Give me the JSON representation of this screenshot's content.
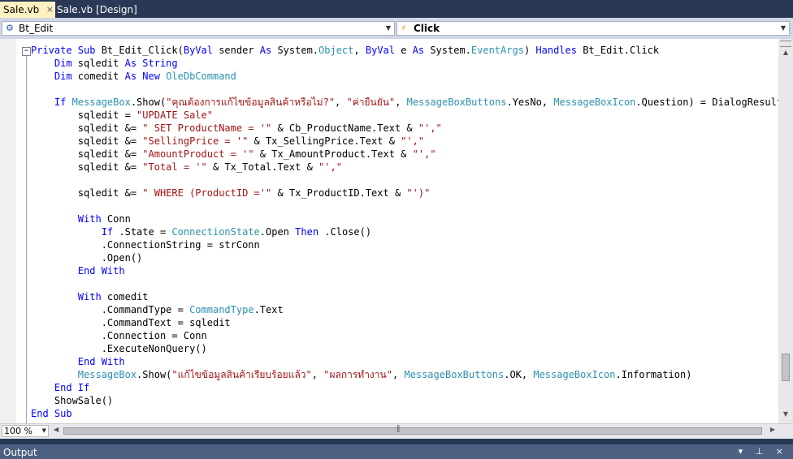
{
  "tabs": [
    {
      "label": "Sale.vb",
      "close": "×"
    },
    {
      "label": "Sale.vb [Design]"
    }
  ],
  "nav": {
    "class_combo": "Bt_Edit",
    "method_combo": "Click"
  },
  "code_lines": [
    [
      {
        "t": "Private Sub ",
        "c": "kw"
      },
      {
        "t": "Bt_Edit_Click(",
        "c": ""
      },
      {
        "t": "ByVal",
        "c": "kw"
      },
      {
        "t": " sender ",
        "c": ""
      },
      {
        "t": "As",
        "c": "kw"
      },
      {
        "t": " System.",
        "c": ""
      },
      {
        "t": "Object",
        "c": "ty"
      },
      {
        "t": ", ",
        "c": ""
      },
      {
        "t": "ByVal",
        "c": "kw"
      },
      {
        "t": " e ",
        "c": ""
      },
      {
        "t": "As",
        "c": "kw"
      },
      {
        "t": " System.",
        "c": ""
      },
      {
        "t": "EventArgs",
        "c": "ty"
      },
      {
        "t": ") ",
        "c": ""
      },
      {
        "t": "Handles",
        "c": "kw"
      },
      {
        "t": " Bt_Edit.Click",
        "c": ""
      }
    ],
    [
      {
        "t": "    Dim",
        "c": "kw"
      },
      {
        "t": " sqledit ",
        "c": ""
      },
      {
        "t": "As String",
        "c": "kw"
      }
    ],
    [
      {
        "t": "    Dim",
        "c": "kw"
      },
      {
        "t": " comedit ",
        "c": ""
      },
      {
        "t": "As New ",
        "c": "kw"
      },
      {
        "t": "OleDbCommand",
        "c": "ty"
      }
    ],
    [],
    [
      {
        "t": "    If ",
        "c": "kw"
      },
      {
        "t": "MessageBox",
        "c": "ty"
      },
      {
        "t": ".Show(",
        "c": ""
      },
      {
        "t": "\"คุณต้องการแก้ไขข้อมูลสินค้าหรือไม่?\"",
        "c": "st"
      },
      {
        "t": ", ",
        "c": ""
      },
      {
        "t": "\"ค่ายืนยัน\"",
        "c": "st"
      },
      {
        "t": ", ",
        "c": ""
      },
      {
        "t": "MessageBoxButtons",
        "c": "ty"
      },
      {
        "t": ".YesNo, ",
        "c": ""
      },
      {
        "t": "MessageBoxIcon",
        "c": "ty"
      },
      {
        "t": ".Question) = DialogResult.Ye",
        "c": ""
      }
    ],
    [
      {
        "t": "        sqledit = ",
        "c": ""
      },
      {
        "t": "\"UPDATE Sale\"",
        "c": "st"
      }
    ],
    [
      {
        "t": "        sqledit &= ",
        "c": ""
      },
      {
        "t": "\" SET ProductName = '\"",
        "c": "st"
      },
      {
        "t": " & Cb_ProductName.Text & ",
        "c": ""
      },
      {
        "t": "\"',\"",
        "c": "st"
      }
    ],
    [
      {
        "t": "        sqledit &= ",
        "c": ""
      },
      {
        "t": "\"SellingPrice = '\"",
        "c": "st"
      },
      {
        "t": " & Tx_SellingPrice.Text & ",
        "c": ""
      },
      {
        "t": "\"',\"",
        "c": "st"
      }
    ],
    [
      {
        "t": "        sqledit &= ",
        "c": ""
      },
      {
        "t": "\"AmountProduct = '\"",
        "c": "st"
      },
      {
        "t": " & Tx_AmountProduct.Text & ",
        "c": ""
      },
      {
        "t": "\"',\"",
        "c": "st"
      }
    ],
    [
      {
        "t": "        sqledit &= ",
        "c": ""
      },
      {
        "t": "\"Total = '\"",
        "c": "st"
      },
      {
        "t": " & Tx_Total.Text & ",
        "c": ""
      },
      {
        "t": "\"',\"",
        "c": "st"
      }
    ],
    [],
    [
      {
        "t": "        sqledit &= ",
        "c": ""
      },
      {
        "t": "\" WHERE (ProductID ='\"",
        "c": "st"
      },
      {
        "t": " & Tx_ProductID.Text & ",
        "c": ""
      },
      {
        "t": "\"')\"",
        "c": "st"
      }
    ],
    [],
    [
      {
        "t": "        With",
        "c": "kw"
      },
      {
        "t": " Conn",
        "c": ""
      }
    ],
    [
      {
        "t": "            If",
        "c": "kw"
      },
      {
        "t": " .State = ",
        "c": ""
      },
      {
        "t": "ConnectionState",
        "c": "ty"
      },
      {
        "t": ".Open ",
        "c": ""
      },
      {
        "t": "Then",
        "c": "kw"
      },
      {
        "t": " .Close()",
        "c": ""
      }
    ],
    [
      {
        "t": "            .ConnectionString = strConn",
        "c": ""
      }
    ],
    [
      {
        "t": "            .Open()",
        "c": ""
      }
    ],
    [
      {
        "t": "        End With",
        "c": "kw"
      }
    ],
    [],
    [
      {
        "t": "        With",
        "c": "kw"
      },
      {
        "t": " comedit",
        "c": ""
      }
    ],
    [
      {
        "t": "            .CommandType = ",
        "c": ""
      },
      {
        "t": "CommandType",
        "c": "ty"
      },
      {
        "t": ".Text",
        "c": ""
      }
    ],
    [
      {
        "t": "            .CommandText = sqledit",
        "c": ""
      }
    ],
    [
      {
        "t": "            .Connection = Conn",
        "c": ""
      }
    ],
    [
      {
        "t": "            .ExecuteNonQuery()",
        "c": ""
      }
    ],
    [
      {
        "t": "        End With",
        "c": "kw"
      }
    ],
    [
      {
        "t": "        ",
        "c": ""
      },
      {
        "t": "MessageBox",
        "c": "ty"
      },
      {
        "t": ".Show(",
        "c": ""
      },
      {
        "t": "\"แก้ไขข้อมูลสินค้าเรียบร้อยแล้ว\"",
        "c": "st"
      },
      {
        "t": ", ",
        "c": ""
      },
      {
        "t": "\"ผลการทำงาน\"",
        "c": "st"
      },
      {
        "t": ", ",
        "c": ""
      },
      {
        "t": "MessageBoxButtons",
        "c": "ty"
      },
      {
        "t": ".OK, ",
        "c": ""
      },
      {
        "t": "MessageBoxIcon",
        "c": "ty"
      },
      {
        "t": ".Information)",
        "c": ""
      }
    ],
    [
      {
        "t": "    End If",
        "c": "kw"
      }
    ],
    [
      {
        "t": "    ShowSale()",
        "c": ""
      }
    ],
    [
      {
        "t": "End Sub",
        "c": "kw"
      }
    ]
  ],
  "zoom": "100 %",
  "output_panel": {
    "title": "Output",
    "pin": "▾ ⊥ ×"
  },
  "colors": {
    "keyword": "#0000ff",
    "type": "#2b91af",
    "string": "#a31515",
    "chrome": "#293955"
  }
}
